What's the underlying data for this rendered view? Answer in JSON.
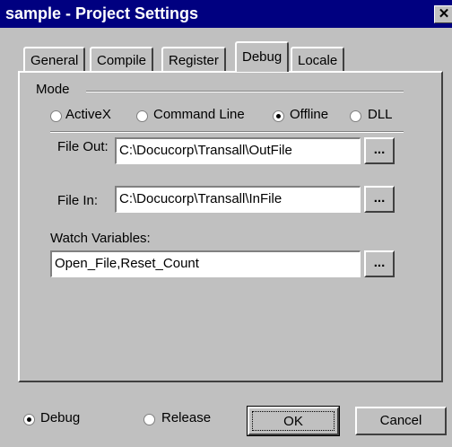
{
  "window": {
    "title": "sample - Project Settings",
    "close_glyph": "✕"
  },
  "tabs": [
    {
      "label": "General",
      "active": false
    },
    {
      "label": "Compile",
      "active": false
    },
    {
      "label": "Register",
      "active": false
    },
    {
      "label": "Debug",
      "active": true
    },
    {
      "label": "Locale",
      "active": false
    }
  ],
  "debug": {
    "mode_label": "Mode",
    "modes": [
      {
        "label": "ActiveX",
        "checked": false
      },
      {
        "label": "Command Line",
        "checked": false
      },
      {
        "label": "Offline",
        "checked": true
      },
      {
        "label": "DLL",
        "checked": false
      }
    ],
    "file_out": {
      "label": "File Out:",
      "value": "C:\\Docucorp\\Transall\\OutFile"
    },
    "file_in": {
      "label": "File In:",
      "value": "C:\\Docucorp\\Transall\\InFile"
    },
    "watch": {
      "label": "Watch Variables:",
      "value": "Open_File,Reset_Count"
    },
    "browse_label": "..."
  },
  "build": {
    "debug_label": "Debug",
    "debug_checked": true,
    "release_label": "Release",
    "release_checked": false
  },
  "buttons": {
    "ok": "OK",
    "cancel": "Cancel"
  }
}
